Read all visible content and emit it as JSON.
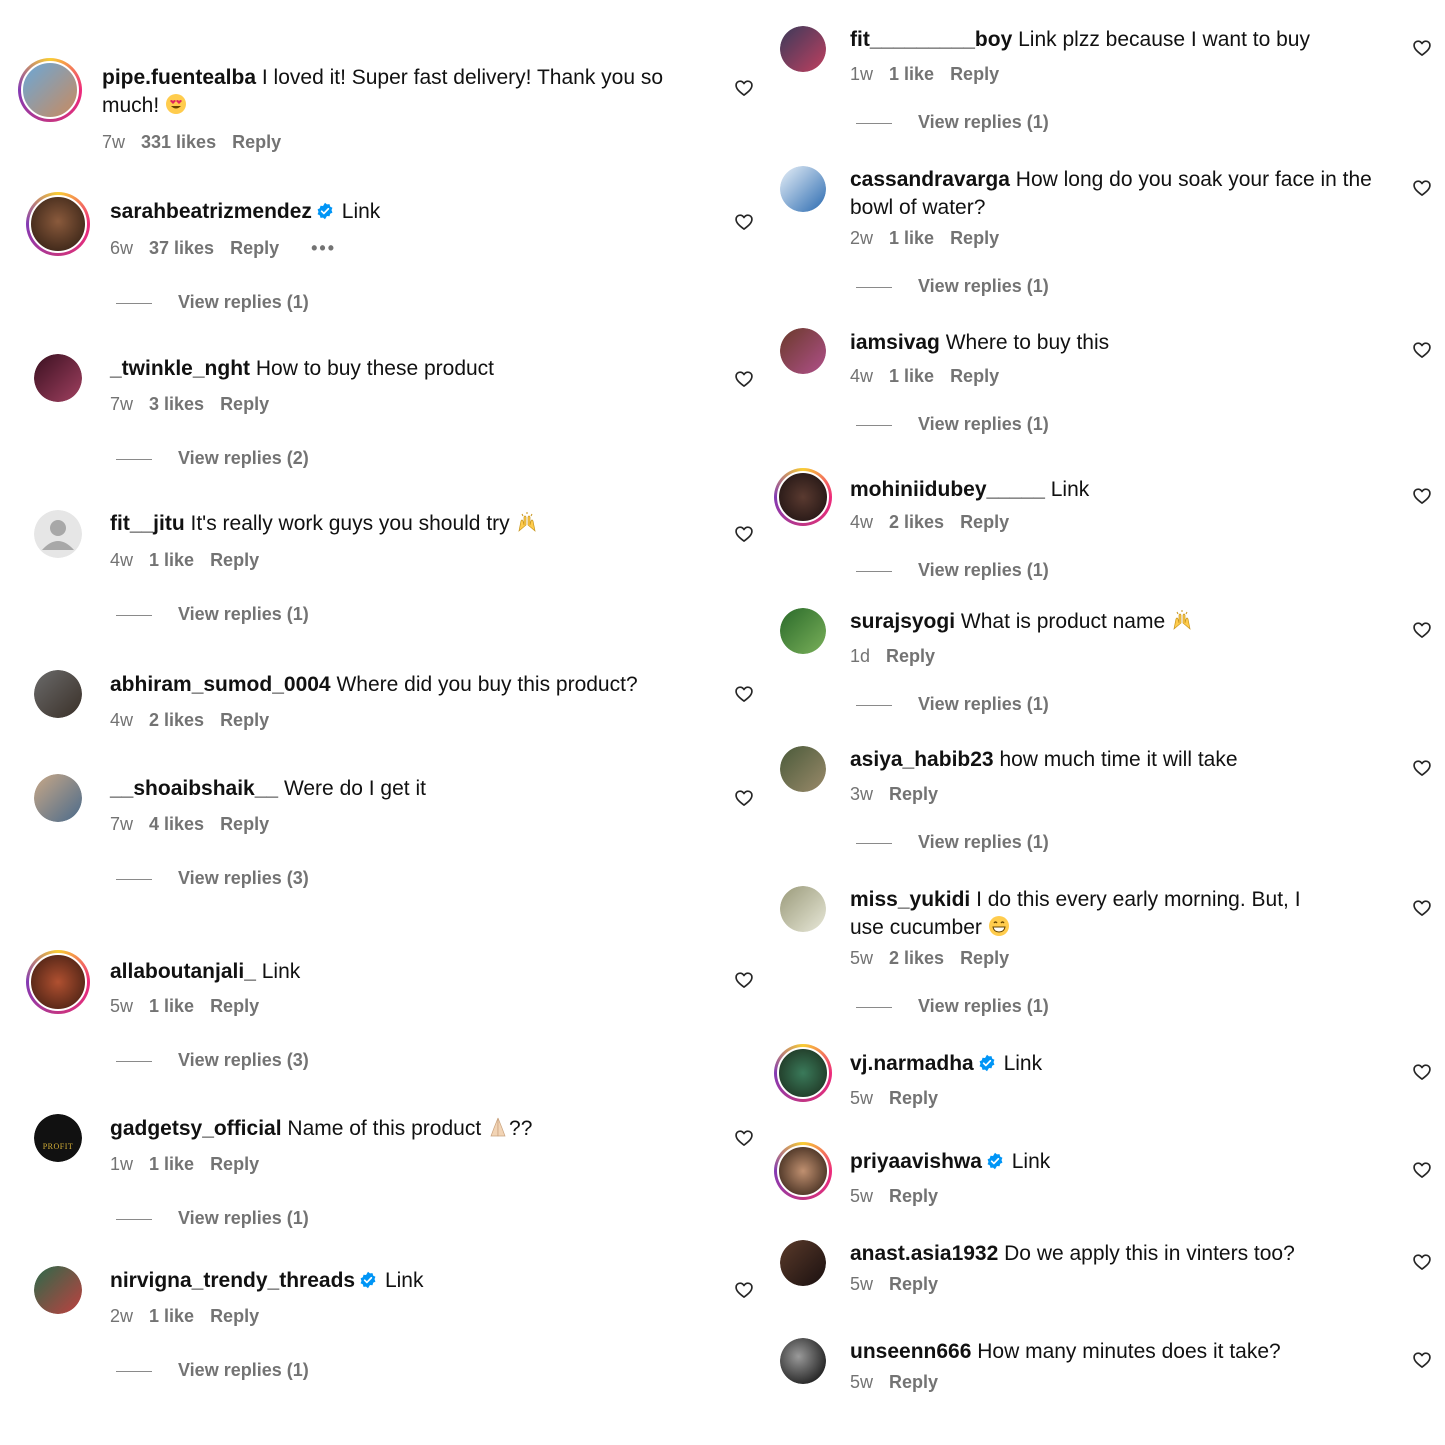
{
  "left_comments": [
    {
      "username": "pipe.fuentealba",
      "verified": false,
      "text": "I loved it! Super fast delivery! Thank you so much!",
      "emoji": "heart-eyes",
      "time": "7w",
      "likes": "331 likes",
      "reply": "Reply",
      "replies": ""
    },
    {
      "username": "sarahbeatrizmendez",
      "verified": true,
      "text": "Link",
      "emoji": "",
      "time": "6w",
      "likes": "37 likes",
      "reply": "Reply",
      "more": "•••",
      "replies": "View replies (1)"
    },
    {
      "username": "_twinkle_nght",
      "verified": false,
      "text": "How to buy these product",
      "emoji": "",
      "time": "7w",
      "likes": "3 likes",
      "reply": "Reply",
      "replies": "View replies (2)"
    },
    {
      "username": "fit__jitu",
      "verified": false,
      "text": "It's really work guys you should try",
      "emoji": "raised-hands",
      "time": "4w",
      "likes": "1 like",
      "reply": "Reply",
      "replies": "View replies (1)"
    },
    {
      "username": "abhiram_sumod_0004",
      "verified": false,
      "text": "Where did you buy this product?",
      "emoji": "",
      "time": "4w",
      "likes": "2 likes",
      "reply": "Reply",
      "replies": ""
    },
    {
      "username": "__shoaibshaik__",
      "verified": false,
      "text": "Were do I get it",
      "emoji": "",
      "time": "7w",
      "likes": "4 likes",
      "reply": "Reply",
      "replies": "View replies (3)"
    },
    {
      "username": "allaboutanjali_",
      "verified": false,
      "text": "Link",
      "emoji": "",
      "time": "5w",
      "likes": "1 like",
      "reply": "Reply",
      "replies": "View replies (3)"
    },
    {
      "username": "gadgetsy_official",
      "verified": false,
      "text": "Name of this product",
      "text_after": "??",
      "emoji": "folded-hands",
      "time": "1w",
      "likes": "1 like",
      "reply": "Reply",
      "replies": "View replies (1)"
    },
    {
      "username": "nirvigna_trendy_threads",
      "verified": true,
      "text": "Link",
      "emoji": "",
      "time": "2w",
      "likes": "1 like",
      "reply": "Reply",
      "replies": "View replies (1)"
    }
  ],
  "right_comments": [
    {
      "username": "fit_________boy",
      "verified": false,
      "text": "Link plzz because I want to buy",
      "emoji": "",
      "time": "1w",
      "likes": "1 like",
      "reply": "Reply",
      "replies": "View replies (1)"
    },
    {
      "username": "cassandravarga",
      "verified": false,
      "text": "How long do you soak your face in the bowl of water?",
      "emoji": "",
      "time": "2w",
      "likes": "1 like",
      "reply": "Reply",
      "replies": "View replies (1)"
    },
    {
      "username": "iamsivag",
      "verified": false,
      "text": "Where to buy this",
      "emoji": "",
      "time": "4w",
      "likes": "1 like",
      "reply": "Reply",
      "replies": "View replies (1)"
    },
    {
      "username": "mohiniidubey_____",
      "verified": false,
      "text": "Link",
      "emoji": "",
      "time": "4w",
      "likes": "2 likes",
      "reply": "Reply",
      "replies": "View replies (1)"
    },
    {
      "username": "surajsyogi",
      "verified": false,
      "text": "What is product name",
      "emoji": "raised-hands",
      "time": "1d",
      "likes": "",
      "reply": "Reply",
      "replies": "View replies (1)"
    },
    {
      "username": "asiya_habib23",
      "verified": false,
      "text": "how much time it will take",
      "emoji": "",
      "time": "3w",
      "likes": "",
      "reply": "Reply",
      "replies": "View replies (1)"
    },
    {
      "username": "miss_yukidi",
      "verified": false,
      "text": "I do this every early morning. But, I use cucumber",
      "emoji": "grin",
      "time": "5w",
      "likes": "2 likes",
      "reply": "Reply",
      "replies": "View replies (1)"
    },
    {
      "username": "vj.narmadha",
      "verified": true,
      "text": "Link",
      "emoji": "",
      "time": "5w",
      "likes": "",
      "reply": "Reply",
      "replies": ""
    },
    {
      "username": "priyaavishwa",
      "verified": true,
      "text": "Link",
      "emoji": "",
      "time": "5w",
      "likes": "",
      "reply": "Reply",
      "replies": ""
    },
    {
      "username": "anast.asia1932",
      "verified": false,
      "text": "Do we apply this in vinters too?",
      "emoji": "",
      "time": "5w",
      "likes": "",
      "reply": "Reply",
      "replies": ""
    },
    {
      "username": "unseenn666",
      "verified": false,
      "text": "How many minutes does it take?",
      "emoji": "",
      "time": "5w",
      "likes": "",
      "reply": "Reply",
      "replies": ""
    }
  ],
  "avatar_logo_text": "PROFIT",
  "colors": {
    "text": "#111111",
    "meta": "#737373",
    "verified": "#0095f6",
    "background": "#ffffff"
  },
  "icons": {
    "like": "heart-outline-icon",
    "verified": "verified-badge-icon"
  }
}
